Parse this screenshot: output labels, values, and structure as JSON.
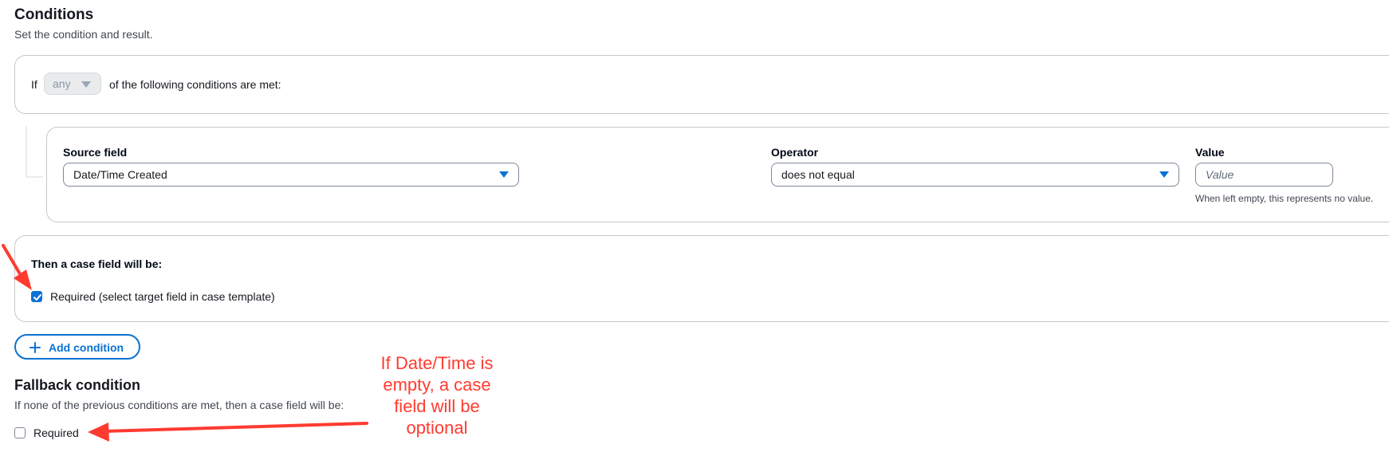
{
  "conditions": {
    "title": "Conditions",
    "subtitle": "Set the condition and result."
  },
  "if_row": {
    "prefix": "If",
    "match_value": "any",
    "suffix": "of the following conditions are met:"
  },
  "rule": {
    "source_field": {
      "label": "Source field",
      "value": "Date/Time Created"
    },
    "operator": {
      "label": "Operator",
      "value": "does not equal"
    },
    "value": {
      "label": "Value",
      "placeholder": "Value",
      "hint": "When left empty, this represents no value."
    }
  },
  "then_block": {
    "label": "Then a case field will be:",
    "checkbox_label": "Required (select target field in case template)",
    "checked": true
  },
  "add_condition": {
    "label": "Add condition"
  },
  "fallback": {
    "title": "Fallback condition",
    "subtitle": "If none of the previous conditions are met, then a case field will be:",
    "checkbox_label": "Required",
    "checked": false
  },
  "annotation": {
    "text_lines": [
      "If Date/Time is",
      "empty, a case",
      "field will be",
      "optional"
    ],
    "color": "#ff3b30"
  },
  "colors": {
    "accent": "#0972d3",
    "border": "#c6c6cd",
    "annotation_red": "#ff3b30"
  }
}
